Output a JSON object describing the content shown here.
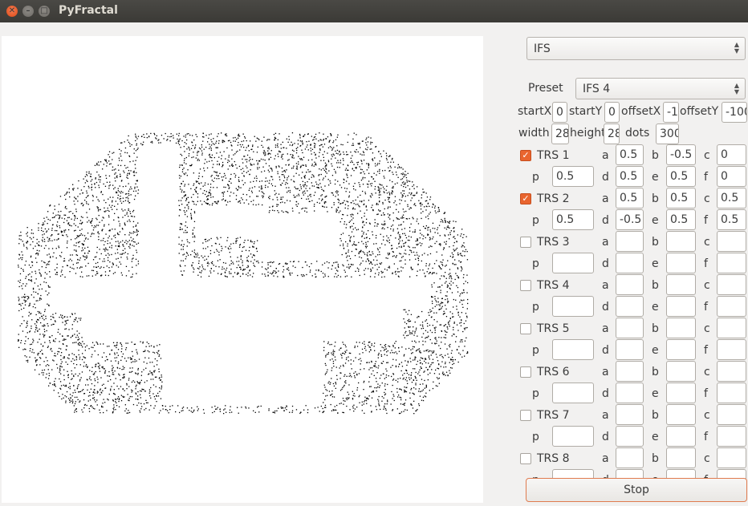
{
  "window": {
    "title": "PyFractal"
  },
  "mode": {
    "selected": "IFS"
  },
  "preset": {
    "label": "Preset",
    "selected": "IFS 4"
  },
  "params": {
    "startX_label": "startX",
    "startX": "0",
    "startY_label": "startY",
    "startY": "0",
    "offsetX_label": "offsetX",
    "offsetX": "-1",
    "offsetY_label": "offsetY",
    "offsetY": "-100",
    "width_label": "width",
    "width": "28",
    "height_label": "height",
    "height": "28",
    "dots_label": "dots",
    "dots": "300"
  },
  "trs_labels": {
    "a": "a",
    "b": "b",
    "c": "c",
    "p": "p",
    "d": "d",
    "e": "e",
    "f": "f"
  },
  "trs": [
    {
      "label": "TRS 1",
      "checked": true,
      "a": "0.5",
      "b": "-0.5",
      "c": "0",
      "p": "0.5",
      "d": "0.5",
      "e": "0.5",
      "f": "0"
    },
    {
      "label": "TRS 2",
      "checked": true,
      "a": "0.5",
      "b": "0.5",
      "c": "0.5",
      "p": "0.5",
      "d": "-0.5",
      "e": "0.5",
      "f": "0.5"
    },
    {
      "label": "TRS 3",
      "checked": false,
      "a": "",
      "b": "",
      "c": "",
      "p": "",
      "d": "",
      "e": "",
      "f": ""
    },
    {
      "label": "TRS 4",
      "checked": false,
      "a": "",
      "b": "",
      "c": "",
      "p": "",
      "d": "",
      "e": "",
      "f": ""
    },
    {
      "label": "TRS 5",
      "checked": false,
      "a": "",
      "b": "",
      "c": "",
      "p": "",
      "d": "",
      "e": "",
      "f": ""
    },
    {
      "label": "TRS 6",
      "checked": false,
      "a": "",
      "b": "",
      "c": "",
      "p": "",
      "d": "",
      "e": "",
      "f": ""
    },
    {
      "label": "TRS 7",
      "checked": false,
      "a": "",
      "b": "",
      "c": "",
      "p": "",
      "d": "",
      "e": "",
      "f": ""
    },
    {
      "label": "TRS 8",
      "checked": false,
      "a": "",
      "b": "",
      "c": "",
      "p": "",
      "d": "",
      "e": "",
      "f": ""
    }
  ],
  "actions": {
    "stop_label": "Stop"
  },
  "colors": {
    "accent": "#e9652f",
    "titlebar": "#3c3b37",
    "dots": "#000000"
  }
}
